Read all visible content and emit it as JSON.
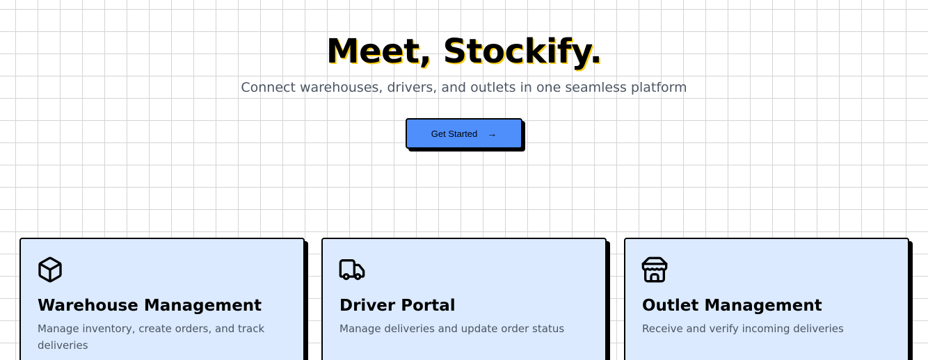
{
  "hero": {
    "title": "Meet, Stockify.",
    "subtitle": "Connect warehouses, drivers, and outlets in one seamless platform",
    "cta_label": "Get Started",
    "cta_arrow": "→"
  },
  "features": [
    {
      "icon": "box-icon",
      "title": "Warehouse Management",
      "description": "Manage inventory, create orders, and track deliveries"
    },
    {
      "icon": "truck-icon",
      "title": "Driver Portal",
      "description": "Manage deliveries and update order status"
    },
    {
      "icon": "store-icon",
      "title": "Outlet Management",
      "description": "Receive and verify incoming deliveries"
    }
  ],
  "colors": {
    "cta_background": "#4f8ffc",
    "card_background": "#dbeafe",
    "title_shadow": "#facc15",
    "muted_text": "#4b5563"
  }
}
